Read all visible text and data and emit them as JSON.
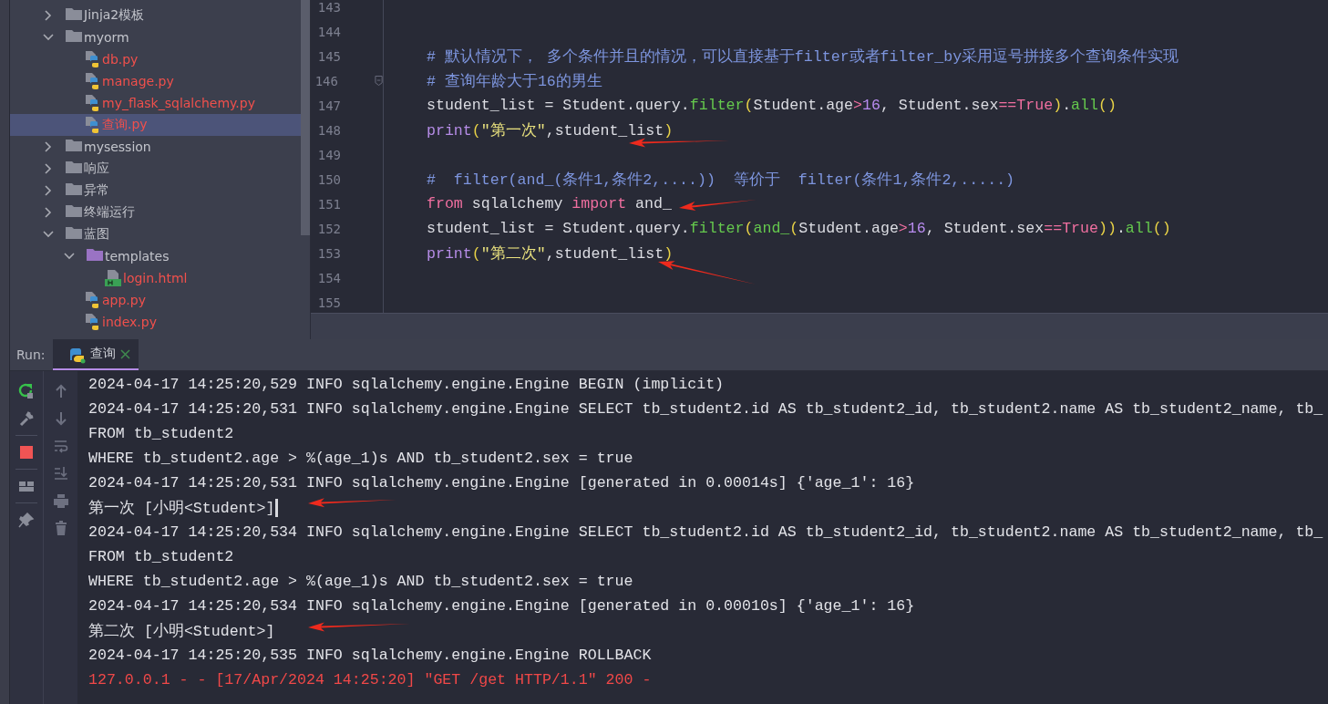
{
  "project_tree": {
    "items": [
      {
        "label": "Jinja2模板",
        "kind": "folder",
        "expanded": false,
        "selected": false,
        "untracked": false
      },
      {
        "label": "myorm",
        "kind": "folder",
        "expanded": true,
        "selected": false,
        "untracked": false,
        "children": [
          {
            "label": "db.py",
            "kind": "python",
            "selected": false,
            "untracked": true
          },
          {
            "label": "manage.py",
            "kind": "python",
            "selected": false,
            "untracked": true
          },
          {
            "label": "my_flask_sqlalchemy.py",
            "kind": "python",
            "selected": false,
            "untracked": true
          },
          {
            "label": "查询.py",
            "kind": "python",
            "selected": true,
            "untracked": true
          }
        ]
      },
      {
        "label": "mysession",
        "kind": "folder",
        "expanded": false,
        "selected": false,
        "untracked": false
      },
      {
        "label": "响应",
        "kind": "folder",
        "expanded": false,
        "selected": false,
        "untracked": false
      },
      {
        "label": "异常",
        "kind": "folder",
        "expanded": false,
        "selected": false,
        "untracked": false
      },
      {
        "label": "终端运行",
        "kind": "folder",
        "expanded": false,
        "selected": false,
        "untracked": false
      },
      {
        "label": "蓝图",
        "kind": "folder",
        "expanded": true,
        "selected": false,
        "untracked": false,
        "children": [
          {
            "label": "templates",
            "kind": "template-folder",
            "expanded": true,
            "selected": false,
            "untracked": false,
            "children": [
              {
                "label": "login.html",
                "kind": "html",
                "selected": false,
                "untracked": true
              }
            ]
          },
          {
            "label": "app.py",
            "kind": "python",
            "selected": false,
            "untracked": true
          },
          {
            "label": "index.py",
            "kind": "python",
            "selected": false,
            "untracked": true
          }
        ]
      }
    ]
  },
  "editor": {
    "lines": [
      {
        "number": "143",
        "fold": false
      },
      {
        "number": "144",
        "fold": false
      },
      {
        "number": "145",
        "fold": false,
        "tokens": [
          {
            "text": "# 默认情况下， 多个条件并且的情况，可以直接基于filter或者filter_by采用逗号拼接多个查询条件实现",
            "kind": "comment"
          }
        ]
      },
      {
        "number": "146",
        "fold": true,
        "tokens": [
          {
            "text": "# 查询年龄大于16的男生",
            "kind": "comment"
          }
        ]
      },
      {
        "number": "147",
        "fold": false,
        "tokens": [
          {
            "text": "student_list = Student.query.",
            "kind": "plain"
          },
          {
            "text": "filter",
            "kind": "func"
          },
          {
            "text": "(",
            "kind": "paren"
          },
          {
            "text": "Student.age",
            "kind": "plain"
          },
          {
            "text": ">",
            "kind": "op"
          },
          {
            "text": "16",
            "kind": "number"
          },
          {
            "text": ", Student.sex",
            "kind": "plain"
          },
          {
            "text": "==",
            "kind": "op"
          },
          {
            "text": "True",
            "kind": "keyword"
          },
          {
            "text": ")",
            "kind": "paren"
          },
          {
            "text": ".",
            "kind": "plain"
          },
          {
            "text": "all",
            "kind": "func"
          },
          {
            "text": "()",
            "kind": "paren"
          }
        ]
      },
      {
        "number": "148",
        "fold": false,
        "tokens": [
          {
            "text": "print",
            "kind": "builtin"
          },
          {
            "text": "(",
            "kind": "paren"
          },
          {
            "text": "\"第一次\"",
            "kind": "string"
          },
          {
            "text": ",student_list",
            "kind": "plain"
          },
          {
            "text": ")",
            "kind": "paren"
          }
        ]
      },
      {
        "number": "149",
        "fold": false
      },
      {
        "number": "150",
        "fold": false,
        "tokens": [
          {
            "text": "#  filter(and_(条件1,条件2,....))  等价于  filter(条件1,条件2,.....)",
            "kind": "comment"
          }
        ]
      },
      {
        "number": "151",
        "fold": false,
        "tokens": [
          {
            "text": "from",
            "kind": "keyword"
          },
          {
            "text": " sqlalchemy ",
            "kind": "plain"
          },
          {
            "text": "import",
            "kind": "keyword"
          },
          {
            "text": " and_",
            "kind": "plain"
          }
        ]
      },
      {
        "number": "152",
        "fold": false,
        "tokens": [
          {
            "text": "student_list = Student.query.",
            "kind": "plain"
          },
          {
            "text": "filter",
            "kind": "func"
          },
          {
            "text": "(",
            "kind": "paren"
          },
          {
            "text": "and_",
            "kind": "func"
          },
          {
            "text": "(",
            "kind": "paren"
          },
          {
            "text": "Student.age",
            "kind": "plain"
          },
          {
            "text": ">",
            "kind": "op"
          },
          {
            "text": "16",
            "kind": "number"
          },
          {
            "text": ", Student.sex",
            "kind": "plain"
          },
          {
            "text": "==",
            "kind": "op"
          },
          {
            "text": "True",
            "kind": "keyword"
          },
          {
            "text": "))",
            "kind": "paren"
          },
          {
            "text": ".",
            "kind": "plain"
          },
          {
            "text": "all",
            "kind": "func"
          },
          {
            "text": "()",
            "kind": "paren"
          }
        ]
      },
      {
        "number": "153",
        "fold": false,
        "tokens": [
          {
            "text": "print",
            "kind": "builtin"
          },
          {
            "text": "(",
            "kind": "paren"
          },
          {
            "text": "\"第二次\"",
            "kind": "string"
          },
          {
            "text": ",student_list",
            "kind": "plain"
          },
          {
            "text": ")",
            "kind": "paren"
          }
        ]
      },
      {
        "number": "154",
        "fold": false
      },
      {
        "number": "155",
        "fold": false
      }
    ]
  },
  "run_panel": {
    "label": "Run:",
    "tabs": [
      {
        "label": "查询",
        "selected": true
      }
    ],
    "console": {
      "lines": [
        {
          "text": "2024-04-17 14:25:20,529 INFO sqlalchemy.engine.Engine BEGIN (implicit)",
          "kind": "log",
          "cursor": false
        },
        {
          "text": "2024-04-17 14:25:20,531 INFO sqlalchemy.engine.Engine SELECT tb_student2.id AS tb_student2_id, tb_student2.name AS tb_student2_name, tb_",
          "kind": "log",
          "cursor": false
        },
        {
          "text": "FROM tb_student2",
          "kind": "log",
          "cursor": false
        },
        {
          "text": "WHERE tb_student2.age > %(age_1)s AND tb_student2.sex = true",
          "kind": "log",
          "cursor": false
        },
        {
          "text": "2024-04-17 14:25:20,531 INFO sqlalchemy.engine.Engine [generated in 0.00014s] {'age_1': 16}",
          "kind": "log",
          "cursor": false
        },
        {
          "text": "第一次 [小明<Student>]",
          "kind": "log",
          "cursor": true
        },
        {
          "text": "2024-04-17 14:25:20,534 INFO sqlalchemy.engine.Engine SELECT tb_student2.id AS tb_student2_id, tb_student2.name AS tb_student2_name, tb_",
          "kind": "log",
          "cursor": false
        },
        {
          "text": "FROM tb_student2",
          "kind": "log",
          "cursor": false
        },
        {
          "text": "WHERE tb_student2.age > %(age_1)s AND tb_student2.sex = true",
          "kind": "log",
          "cursor": false
        },
        {
          "text": "2024-04-17 14:25:20,534 INFO sqlalchemy.engine.Engine [generated in 0.00010s] {'age_1': 16}",
          "kind": "log",
          "cursor": false
        },
        {
          "text": "第二次 [小明<Student>]",
          "kind": "log",
          "cursor": false
        },
        {
          "text": "2024-04-17 14:25:20,535 INFO sqlalchemy.engine.Engine ROLLBACK",
          "kind": "log",
          "cursor": false
        },
        {
          "text": "127.0.0.1 - - [17/Apr/2024 14:25:20] \"GET /get HTTP/1.1\" 200 -",
          "kind": "error",
          "cursor": false
        }
      ]
    }
  }
}
